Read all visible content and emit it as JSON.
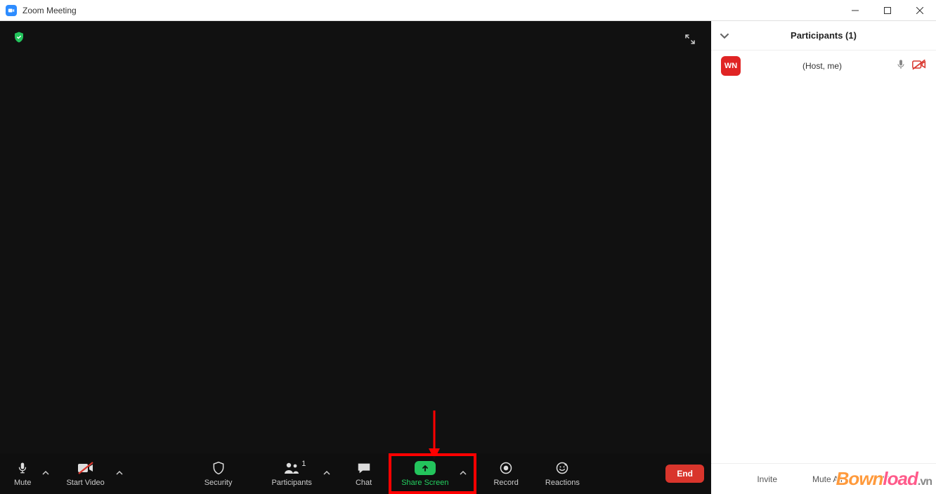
{
  "window": {
    "title": "Zoom Meeting"
  },
  "toolbar": {
    "mute": "Mute",
    "start_video": "Start Video",
    "security": "Security",
    "participants": "Participants",
    "participants_count": "1",
    "chat": "Chat",
    "share_screen": "Share Screen",
    "record": "Record",
    "reactions": "Reactions",
    "end": "End"
  },
  "participants_panel": {
    "title": "Participants (1)",
    "items": [
      {
        "avatar": "WN",
        "label": "(Host, me)"
      }
    ],
    "footer": {
      "invite": "Invite",
      "mute_all": "Mute All"
    }
  },
  "watermark": {
    "left": "Bown",
    "right": "load",
    "suffix": ".vn"
  }
}
